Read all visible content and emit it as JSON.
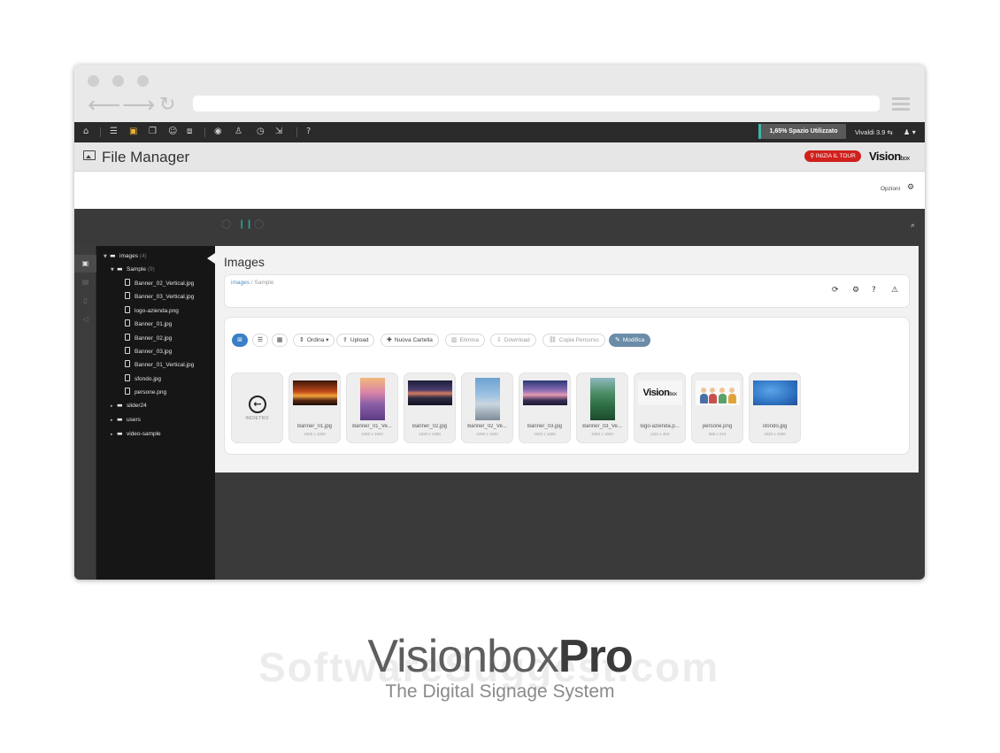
{
  "toolbar": {
    "storage_label": "1,65% Spazio Utilizzato",
    "user_label": "Vivaldi 3.9 ⇆"
  },
  "header": {
    "title": "File Manager",
    "tour_button": "INIZIA IL TOUR",
    "brand_main": "Vision",
    "brand_small": "box"
  },
  "options": {
    "label": "Opzioni"
  },
  "tree": {
    "root": {
      "label": "images",
      "count": "(4)"
    },
    "sample": {
      "label": "Sample",
      "count": "(9)"
    },
    "files": [
      "Banner_02_Vertical.jpg",
      "Banner_03_Vertical.jpg",
      "logo-azienda.png",
      "Banner_01.jpg",
      "Banner_02.jpg",
      "Banner_03.jpg",
      "Banner_01_Vertical.jpg",
      "sfondo.jpg",
      "persone.png"
    ],
    "folders": [
      "slider24",
      "users",
      "video-sample"
    ]
  },
  "main": {
    "title": "Images",
    "breadcrumb_root": "images",
    "breadcrumb_current": "Sample"
  },
  "gallery_toolbar": {
    "sort": "Ordina",
    "upload": "Upload",
    "new_folder": "Nuova Cartella",
    "delete": "Elimina",
    "download": "Download",
    "copy_path": "Copia Percorso",
    "edit": "Modifica"
  },
  "back_tile": {
    "label": "INDIETRO"
  },
  "tiles": [
    {
      "name": "Banner_01.jpg",
      "dims": "1920 x 1080",
      "thumb": "sunset"
    },
    {
      "name": "Banner_01_Ve...",
      "dims": "1080 x 1920",
      "thumb": "lavender"
    },
    {
      "name": "Banner_02.jpg",
      "dims": "1920 x 1080",
      "thumb": "night"
    },
    {
      "name": "Banner_02_Ve...",
      "dims": "1080 x 1920",
      "thumb": "city"
    },
    {
      "name": "Banner_03.jpg",
      "dims": "1920 x 1080",
      "thumb": "dusk"
    },
    {
      "name": "Banner_03_Ve...",
      "dims": "1080 x 1920",
      "thumb": "forest"
    },
    {
      "name": "logo-azienda.p...",
      "dims": "1115 x 464",
      "thumb": "logo"
    },
    {
      "name": "persone.png",
      "dims": "388 x 244",
      "thumb": "people"
    },
    {
      "name": "sfondo.jpg",
      "dims": "1920 x 1080",
      "thumb": "blue"
    }
  ],
  "watermark": {
    "brand": "Visionbox",
    "brand_bold": "Pro",
    "tagline": "The Digital Signage System",
    "site": "SoftwareSuggest.com"
  }
}
